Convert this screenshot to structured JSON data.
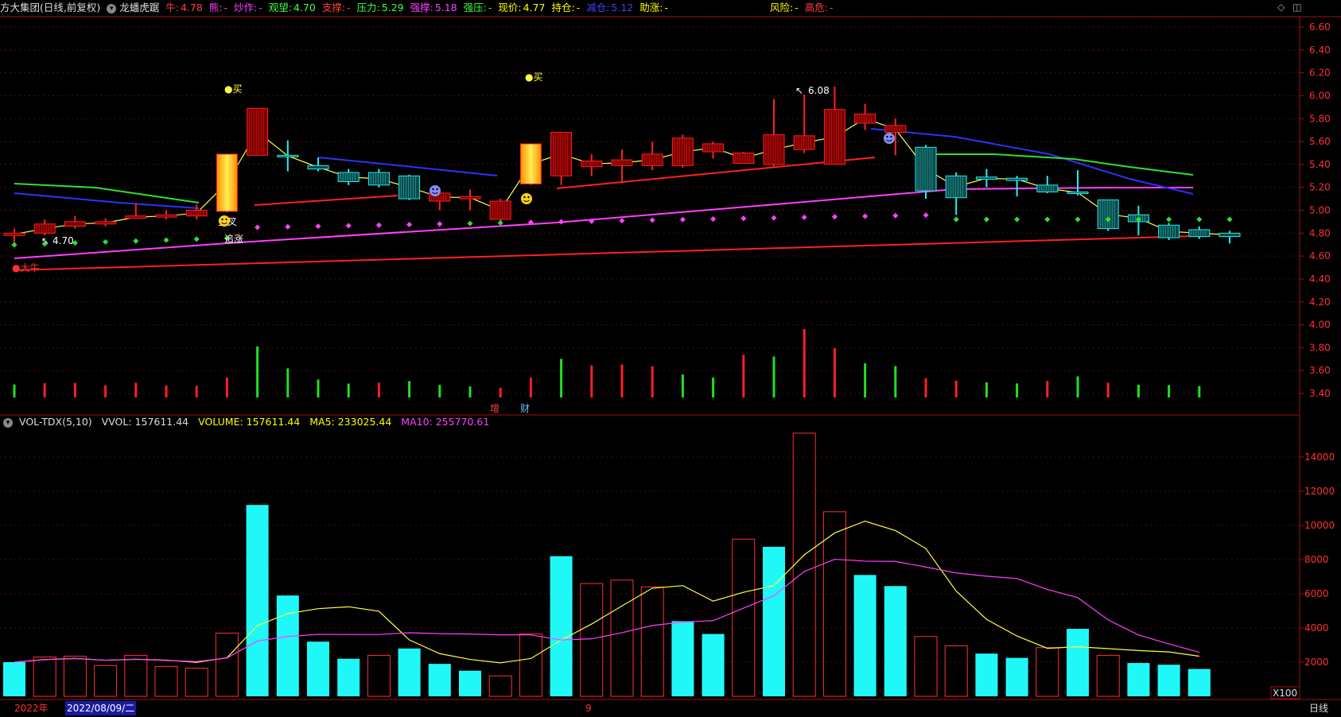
{
  "header": {
    "stock_name": "方大集团(日线,前复权)",
    "indicator_name": "龙蟠虎踞",
    "items": [
      {
        "label": "牛:",
        "value": "4.78",
        "label_color": "#ff4040",
        "value_color": "#ff4040"
      },
      {
        "label": "熊:",
        "value": "-",
        "label_color": "#ff40ff",
        "value_color": "#ff40ff"
      },
      {
        "label": "炒作:",
        "value": "-",
        "label_color": "#ff40ff",
        "value_color": "#ff40ff"
      },
      {
        "label": "观望:",
        "value": "4.70",
        "label_color": "#40ff40",
        "value_color": "#40ff40"
      },
      {
        "label": "支撑:",
        "value": "-",
        "label_color": "#ff4040",
        "value_color": "#ff4040"
      },
      {
        "label": "压力:",
        "value": "5.29",
        "label_color": "#40ff40",
        "value_color": "#40ff40"
      },
      {
        "label": "强撑:",
        "value": "5.18",
        "label_color": "#ff40ff",
        "value_color": "#ff40ff"
      },
      {
        "label": "强压:",
        "value": "-",
        "label_color": "#40ff40",
        "value_color": "#40ff40"
      },
      {
        "label": "现价:",
        "value": "4.77",
        "label_color": "#ffff00",
        "value_color": "#ffff00"
      },
      {
        "label": "持仓:",
        "value": "-",
        "label_color": "#ffff00",
        "value_color": "#ffff00"
      },
      {
        "label": "减仓:",
        "value": "5.12",
        "label_color": "#4040ff",
        "value_color": "#4040ff"
      },
      {
        "label": "助涨:",
        "value": "-",
        "label_color": "#ffff00",
        "value_color": "#ffff00"
      },
      {
        "label": "风险:",
        "value": "-",
        "label_color": "#ffff00",
        "value_color": "#ffff00"
      },
      {
        "label": "高危:",
        "value": "-",
        "label_color": "#ff4040",
        "value_color": "#ff4040"
      }
    ],
    "controls": [
      "◇",
      "◫"
    ]
  },
  "price_axis": {
    "ticks": [
      "6.60",
      "6.40",
      "6.20",
      "6.00",
      "5.80",
      "5.60",
      "5.40",
      "5.20",
      "5.00",
      "4.80",
      "4.60",
      "4.40",
      "4.20",
      "4.00",
      "3.80",
      "3.60",
      "3.40"
    ],
    "color": "#ff3030"
  },
  "annotations": {
    "buy1": "●买",
    "buy2": "●买",
    "high_label": "6.08",
    "low_label": "4.70",
    "golden_cross": "金叉",
    "chase": "追涨",
    "daniu": "●大牛",
    "zeng": "增",
    "cai": "财"
  },
  "volume": {
    "title": "VOL-TDX(5,10)",
    "vvol": "VVOL: 157611.44",
    "volume": "VOLUME: 157611.44",
    "ma5": "MA5: 233025.44",
    "ma10": "MA10: 255770.61",
    "ticks": [
      "14000",
      "12000",
      "10000",
      "8000",
      "6000",
      "4000",
      "2000"
    ],
    "unit": "X100"
  },
  "footer": {
    "year": "2022年",
    "date": "2022/08/09/二",
    "month_marker": "9",
    "period": "日线"
  },
  "chart_data": {
    "type": "candlestick",
    "candles": [
      {
        "o": 4.78,
        "c": 4.8,
        "h": 4.84,
        "l": 4.72
      },
      {
        "o": 4.8,
        "c": 4.88,
        "h": 4.92,
        "l": 4.78
      },
      {
        "o": 4.86,
        "c": 4.9,
        "h": 4.95,
        "l": 4.84
      },
      {
        "o": 4.88,
        "c": 4.9,
        "h": 4.93,
        "l": 4.86
      },
      {
        "o": 4.93,
        "c": 4.95,
        "h": 5.06,
        "l": 4.93
      },
      {
        "o": 4.94,
        "c": 4.96,
        "h": 5.0,
        "l": 4.92
      },
      {
        "o": 4.95,
        "c": 5.0,
        "h": 5.05,
        "l": 4.92
      },
      {
        "o": 4.99,
        "c": 5.49,
        "h": 5.49,
        "l": 4.98
      },
      {
        "o": 5.48,
        "c": 5.89,
        "h": 5.89,
        "l": 5.48
      },
      {
        "o": 5.48,
        "c": 5.47,
        "h": 5.61,
        "l": 5.34
      },
      {
        "o": 5.39,
        "c": 5.36,
        "h": 5.46,
        "l": 5.34
      },
      {
        "o": 5.33,
        "c": 5.25,
        "h": 5.36,
        "l": 5.22
      },
      {
        "o": 5.33,
        "c": 5.22,
        "h": 5.36,
        "l": 5.2
      },
      {
        "o": 5.3,
        "c": 5.1,
        "h": 5.31,
        "l": 5.09
      },
      {
        "o": 5.08,
        "c": 5.15,
        "h": 5.16,
        "l": 5.0
      },
      {
        "o": 5.1,
        "c": 5.12,
        "h": 5.18,
        "l": 5.0
      },
      {
        "o": 4.92,
        "c": 5.08,
        "h": 5.1,
        "l": 4.9
      },
      {
        "o": 5.23,
        "c": 5.58,
        "h": 5.58,
        "l": 5.22
      },
      {
        "o": 5.3,
        "c": 5.68,
        "h": 5.68,
        "l": 5.22
      },
      {
        "o": 5.38,
        "c": 5.43,
        "h": 5.49,
        "l": 5.3
      },
      {
        "o": 5.39,
        "c": 5.44,
        "h": 5.53,
        "l": 5.25
      },
      {
        "o": 5.39,
        "c": 5.49,
        "h": 5.6,
        "l": 5.35
      },
      {
        "o": 5.39,
        "c": 5.63,
        "h": 5.66,
        "l": 5.37
      },
      {
        "o": 5.51,
        "c": 5.58,
        "h": 5.6,
        "l": 5.45
      },
      {
        "o": 5.41,
        "c": 5.5,
        "h": 5.51,
        "l": 5.41
      },
      {
        "o": 5.4,
        "c": 5.66,
        "h": 5.97,
        "l": 5.38
      },
      {
        "o": 5.53,
        "c": 5.65,
        "h": 6.01,
        "l": 5.5
      },
      {
        "o": 5.4,
        "c": 5.88,
        "h": 6.08,
        "l": 5.4
      },
      {
        "o": 5.76,
        "c": 5.84,
        "h": 5.93,
        "l": 5.7
      },
      {
        "o": 5.68,
        "c": 5.74,
        "h": 5.8,
        "l": 5.48
      },
      {
        "o": 5.55,
        "c": 5.17,
        "h": 5.57,
        "l": 5.1
      },
      {
        "o": 5.3,
        "c": 5.11,
        "h": 5.33,
        "l": 4.96
      },
      {
        "o": 5.29,
        "c": 5.27,
        "h": 5.36,
        "l": 5.2
      },
      {
        "o": 5.28,
        "c": 5.26,
        "h": 5.3,
        "l": 5.12
      },
      {
        "o": 5.22,
        "c": 5.16,
        "h": 5.3,
        "l": 5.15
      },
      {
        "o": 5.16,
        "c": 5.15,
        "h": 5.35,
        "l": 5.13
      },
      {
        "o": 5.09,
        "c": 4.84,
        "h": 5.09,
        "l": 4.82
      },
      {
        "o": 4.96,
        "c": 4.9,
        "h": 5.04,
        "l": 4.78
      },
      {
        "o": 4.87,
        "c": 4.76,
        "h": 4.89,
        "l": 4.74
      },
      {
        "o": 4.83,
        "c": 4.77,
        "h": 4.86,
        "l": 4.75
      },
      {
        "o": 4.8,
        "c": 4.77,
        "h": 4.82,
        "l": 4.71
      }
    ],
    "volumes": [
      {
        "v": 2000,
        "up": false
      },
      {
        "v": 2300,
        "up": true
      },
      {
        "v": 2350,
        "up": true
      },
      {
        "v": 1800,
        "up": true
      },
      {
        "v": 2400,
        "up": true
      },
      {
        "v": 1750,
        "up": true
      },
      {
        "v": 1650,
        "up": true
      },
      {
        "v": 3700,
        "up": true
      },
      {
        "v": 11200,
        "up": false
      },
      {
        "v": 5900,
        "up": false
      },
      {
        "v": 3200,
        "up": false
      },
      {
        "v": 2200,
        "up": false
      },
      {
        "v": 2400,
        "up": true
      },
      {
        "v": 2800,
        "up": false
      },
      {
        "v": 1900,
        "up": false
      },
      {
        "v": 1500,
        "up": false
      },
      {
        "v": 1200,
        "up": true
      },
      {
        "v": 3650,
        "up": true
      },
      {
        "v": 8200,
        "up": false
      },
      {
        "v": 6600,
        "up": true
      },
      {
        "v": 6800,
        "up": true
      },
      {
        "v": 6400,
        "up": true
      },
      {
        "v": 4400,
        "up": false
      },
      {
        "v": 3650,
        "up": false
      },
      {
        "v": 9200,
        "up": true
      },
      {
        "v": 8750,
        "up": false
      },
      {
        "v": 15400,
        "up": true
      },
      {
        "v": 10800,
        "up": true
      },
      {
        "v": 7100,
        "up": false
      },
      {
        "v": 6450,
        "up": false
      },
      {
        "v": 3500,
        "up": true
      },
      {
        "v": 2950,
        "up": true
      },
      {
        "v": 2500,
        "up": false
      },
      {
        "v": 2250,
        "up": false
      },
      {
        "v": 2850,
        "up": true
      },
      {
        "v": 3950,
        "up": false
      },
      {
        "v": 2400,
        "up": true
      },
      {
        "v": 1950,
        "up": false
      },
      {
        "v": 1850,
        "up": false
      },
      {
        "v": 1600,
        "up": false
      }
    ],
    "price_range": [
      3.4,
      6.6
    ],
    "volume_range": [
      0,
      15400
    ]
  }
}
